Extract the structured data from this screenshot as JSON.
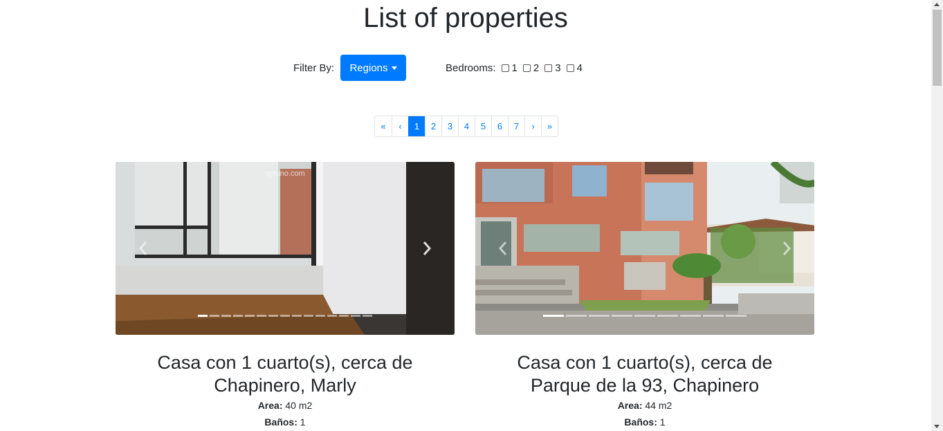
{
  "page": {
    "title": "List of properties"
  },
  "filters": {
    "filter_label": "Filter By:",
    "regions_label": "Regions",
    "bedrooms_label": "Bedrooms:",
    "bedroom_options": [
      "1",
      "2",
      "3",
      "4"
    ]
  },
  "pagination": {
    "first": "«",
    "prev": "‹",
    "pages": [
      "1",
      "2",
      "3",
      "4",
      "5",
      "6",
      "7"
    ],
    "active_page": "1",
    "next": "›",
    "last": "»"
  },
  "listings": [
    {
      "title": "Casa con 1 cuarto(s), cerca de Chapinero, Marly",
      "area_label": "Area:",
      "area_value": "40 m2",
      "baths_label": "Baños:",
      "baths_value": "1",
      "watermark": "aptuno.com",
      "slide_count": 15,
      "active_slide": 1
    },
    {
      "title": "Casa con 1 cuarto(s), cerca de Parque de la 93, Chapinero",
      "area_label": "Area:",
      "area_value": "44 m2",
      "baths_label": "Baños:",
      "baths_value": "1",
      "slide_count": 9,
      "active_slide": 1
    }
  ],
  "colors": {
    "accent": "#007bff",
    "text": "#212529"
  }
}
